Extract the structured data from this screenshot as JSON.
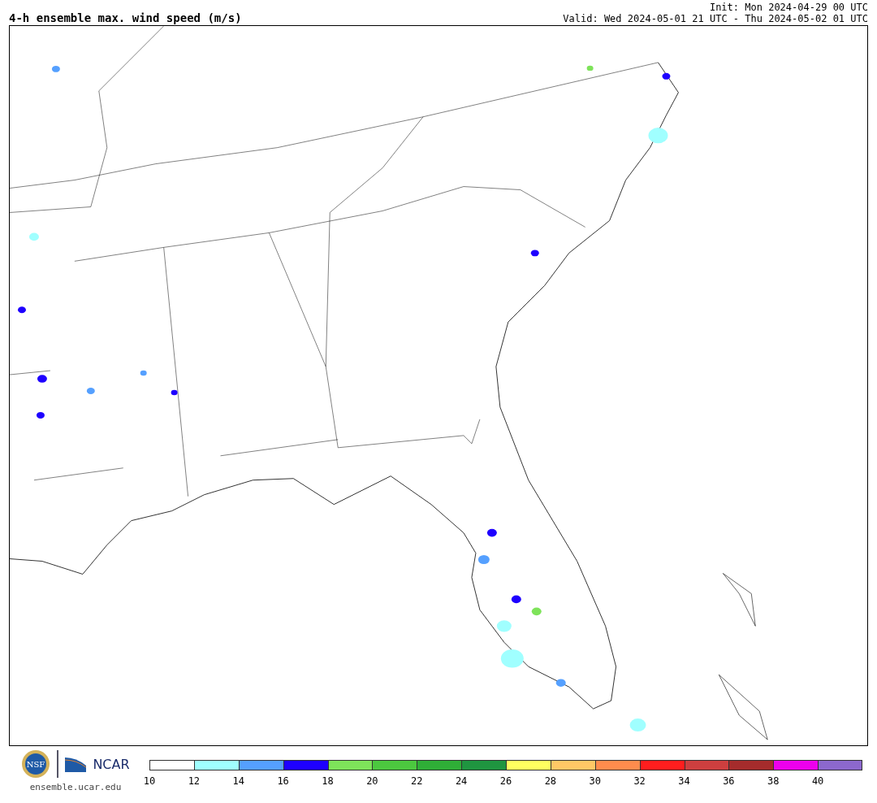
{
  "title": "4-h ensemble max. wind speed (m/s)",
  "init": "Init: Mon 2024-04-29 00 UTC",
  "valid": "Valid: Wed 2024-05-01 21 UTC - Thu 2024-05-02 01 UTC",
  "logos": {
    "nsf": "NSF",
    "ncar": "NCAR",
    "url": "ensemble.ucar.edu"
  },
  "colorbar": {
    "segments": [
      {
        "color": "#ffffff",
        "label": "10"
      },
      {
        "color": "#a0ffff",
        "label": "12"
      },
      {
        "color": "#55a0ff",
        "label": "14"
      },
      {
        "color": "#1e00ff",
        "label": "16"
      },
      {
        "color": "#7ee35a",
        "label": "18"
      },
      {
        "color": "#4cc83f",
        "label": "20"
      },
      {
        "color": "#2fae37",
        "label": "22"
      },
      {
        "color": "#1f9540",
        "label": "24"
      },
      {
        "color": "#ffff60",
        "label": "26"
      },
      {
        "color": "#ffc866",
        "label": "28"
      },
      {
        "color": "#ff8c4d",
        "label": "30"
      },
      {
        "color": "#ff1e1e",
        "label": "32"
      },
      {
        "color": "#cd3f3f",
        "label": "34"
      },
      {
        "color": "#a52c2c",
        "label": "36"
      },
      {
        "color": "#ed00ed",
        "label": "38"
      },
      {
        "color": "#8c68cd",
        "label": "40"
      }
    ]
  }
}
